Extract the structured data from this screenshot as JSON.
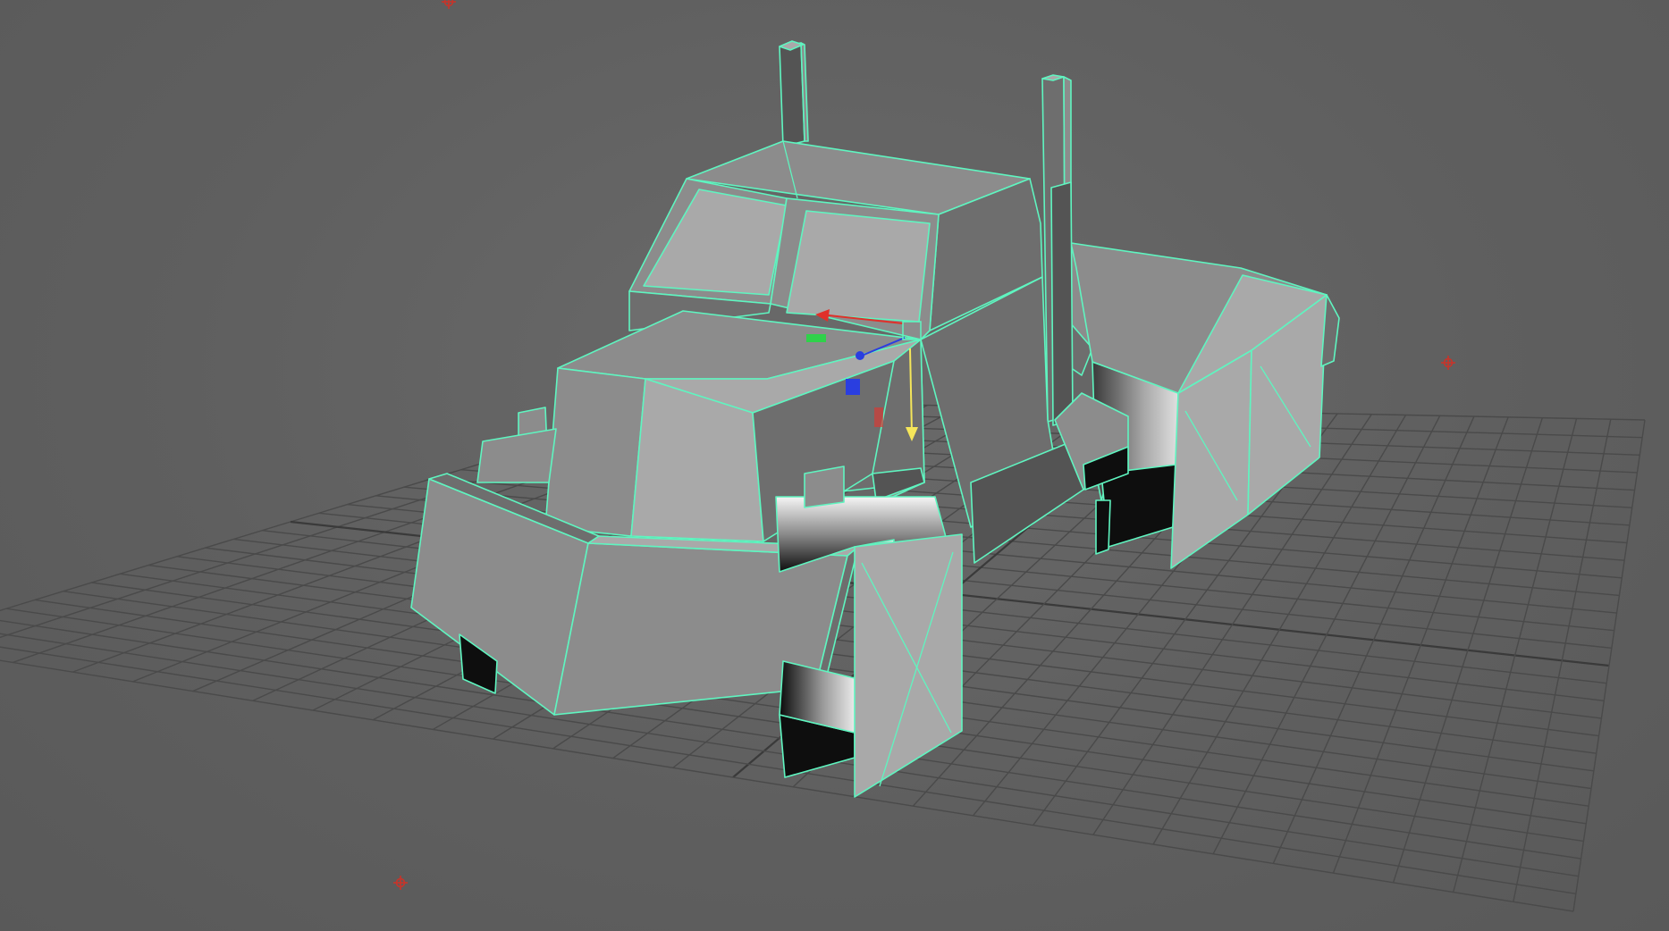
{
  "viewport": {
    "panel": "perspective",
    "background_color": "#5f5f5f",
    "grid_color": "#4a4a4a",
    "wireframe_highlight_color": "#5ff5c0"
  },
  "scene": {
    "object": "truck-cab-model",
    "selected": true,
    "shading": "smooth-shade-with-wireframe"
  },
  "manipulator": {
    "x_axis_color": "#e0302a",
    "y_axis_color": "#2fd24a",
    "z_axis_color": "#2a3ee0",
    "handle_color": "#f5e65a"
  },
  "locators": {
    "icon": "locator-cross-icon",
    "color": "#c8342a"
  }
}
